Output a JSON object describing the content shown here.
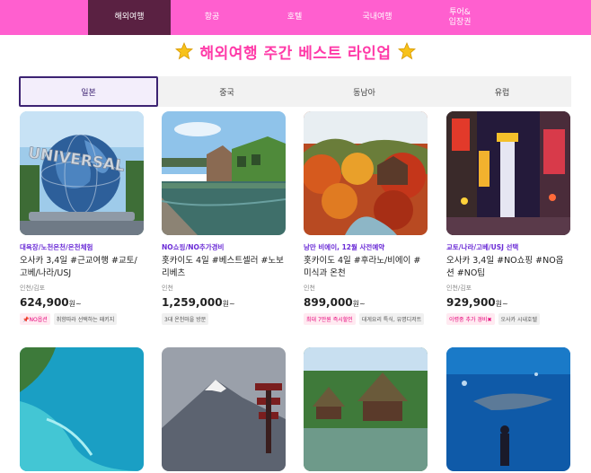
{
  "nav": {
    "items": [
      "해외여행",
      "항공",
      "호텔",
      "국내여행",
      "투어&\n입장권"
    ],
    "active_index": 0
  },
  "headline": {
    "title": "해외여행 주간 베스트 라인업",
    "star_icon": "star-icon"
  },
  "tabs": {
    "items": [
      "일본",
      "중국",
      "동남아",
      "유럽"
    ],
    "active_index": 0
  },
  "products": [
    {
      "tagline": "대욕장/노천온천/온천체험",
      "name": "오사카 3,4일 #근교여행 #교토/고베/나라/USJ",
      "departure": "인천/김포",
      "price": "624,900",
      "currency": "원~",
      "badges": [
        {
          "text": "NO옵션",
          "style": "pink",
          "icon": "pin-icon"
        },
        {
          "text": "취향따라 선택하는 패키지",
          "style": "gray"
        }
      ]
    },
    {
      "tagline": "NO쇼핑/NO추가경비",
      "name": "홋카이도 4일 #베스트셀러 #노보리베츠",
      "departure": "인천",
      "price": "1,259,000",
      "currency": "원~",
      "badges": [
        {
          "text": "3대 온천마을 방문",
          "style": "gray"
        }
      ]
    },
    {
      "tagline": "낭만 비에이, 12월 사전예약",
      "name": "홋카이도 4일 #후라노/비에이 #미식과 온천",
      "departure": "인천",
      "price": "899,000",
      "currency": "원~",
      "badges": [
        {
          "text": "최대 7만원 즉시할인",
          "style": "pink"
        },
        {
          "text": "대게요리 특식, 유명디저트",
          "style": "gray"
        }
      ]
    },
    {
      "tagline": "교토/나라/고베/USJ 선택",
      "name": "오사카 3,4일 #NO쇼핑 #NO옵션 #NO팁",
      "departure": "인천/김포",
      "price": "929,900",
      "currency": "원~",
      "badges": [
        {
          "text": "이령중 추가 경비",
          "style": "pink",
          "icon": "x-icon"
        },
        {
          "text": "오사카 시내호텔",
          "style": "gray"
        }
      ]
    }
  ],
  "colors": {
    "nav_bg": "#ff5fcf",
    "nav_active": "#5a2142",
    "headline": "#ff3aa8",
    "tagline": "#6a2bd6",
    "tab_active_border": "#3c2372"
  }
}
